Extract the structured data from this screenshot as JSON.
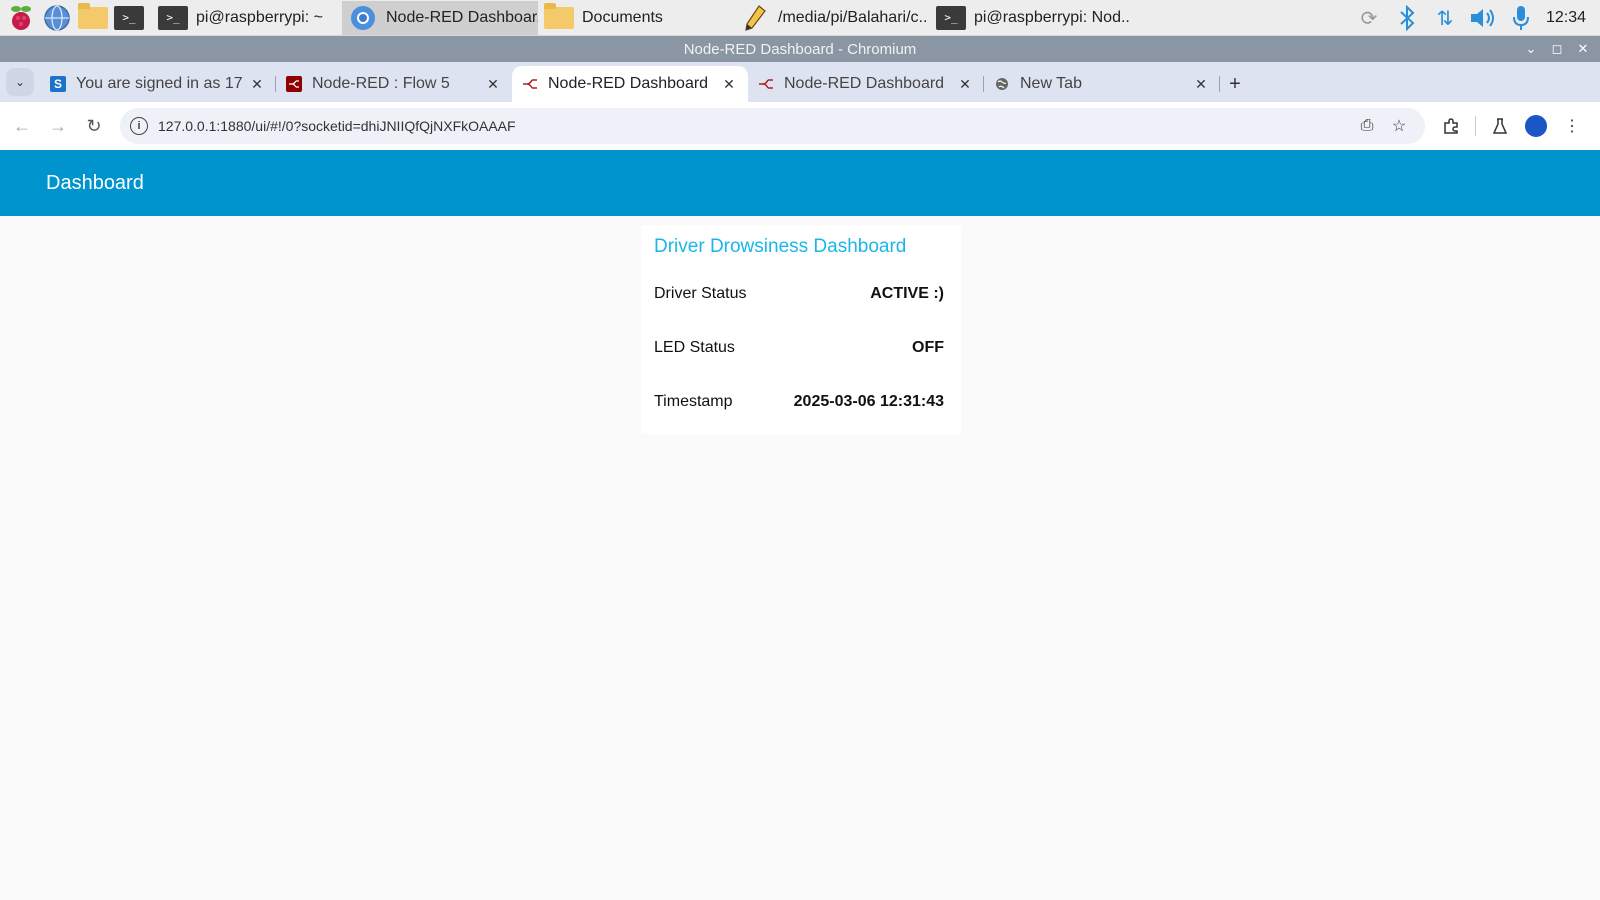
{
  "taskbar": {
    "tasks": [
      {
        "label": "pi@raspberrypi: ~"
      },
      {
        "label": "Node-RED Dashboar.."
      },
      {
        "label": "Documents"
      },
      {
        "label": "/media/pi/Balahari/c.."
      },
      {
        "label": "pi@raspberrypi: Nod.."
      }
    ],
    "clock": "12:34"
  },
  "window": {
    "title": "Node-RED Dashboard - Chromium"
  },
  "tabs": [
    {
      "title": "You are signed in as 17",
      "icon": "s-favicon"
    },
    {
      "title": "Node-RED : Flow 5",
      "icon": "node-red-favicon"
    },
    {
      "title": "Node-RED Dashboard",
      "icon": "node-red-favicon"
    },
    {
      "title": "Node-RED Dashboard",
      "icon": "node-red-favicon"
    },
    {
      "title": "New Tab",
      "icon": "globe-icon"
    }
  ],
  "address_bar": {
    "url": "127.0.0.1:1880/ui/#!/0?socketid=dhiJNIIQfQjNXFkOAAAF"
  },
  "dashboard": {
    "header_title": "Dashboard",
    "card_title": "Driver Drowsiness Dashboard",
    "rows": [
      {
        "label": "Driver Status",
        "value": "ACTIVE :)"
      },
      {
        "label": "LED Status",
        "value": "OFF"
      },
      {
        "label": "Timestamp",
        "value": "2025-03-06 12:31:43"
      }
    ]
  },
  "colors": {
    "header_bg": "#0094ce",
    "card_title": "#1bb6e9",
    "page_bg": "#fafafa"
  }
}
